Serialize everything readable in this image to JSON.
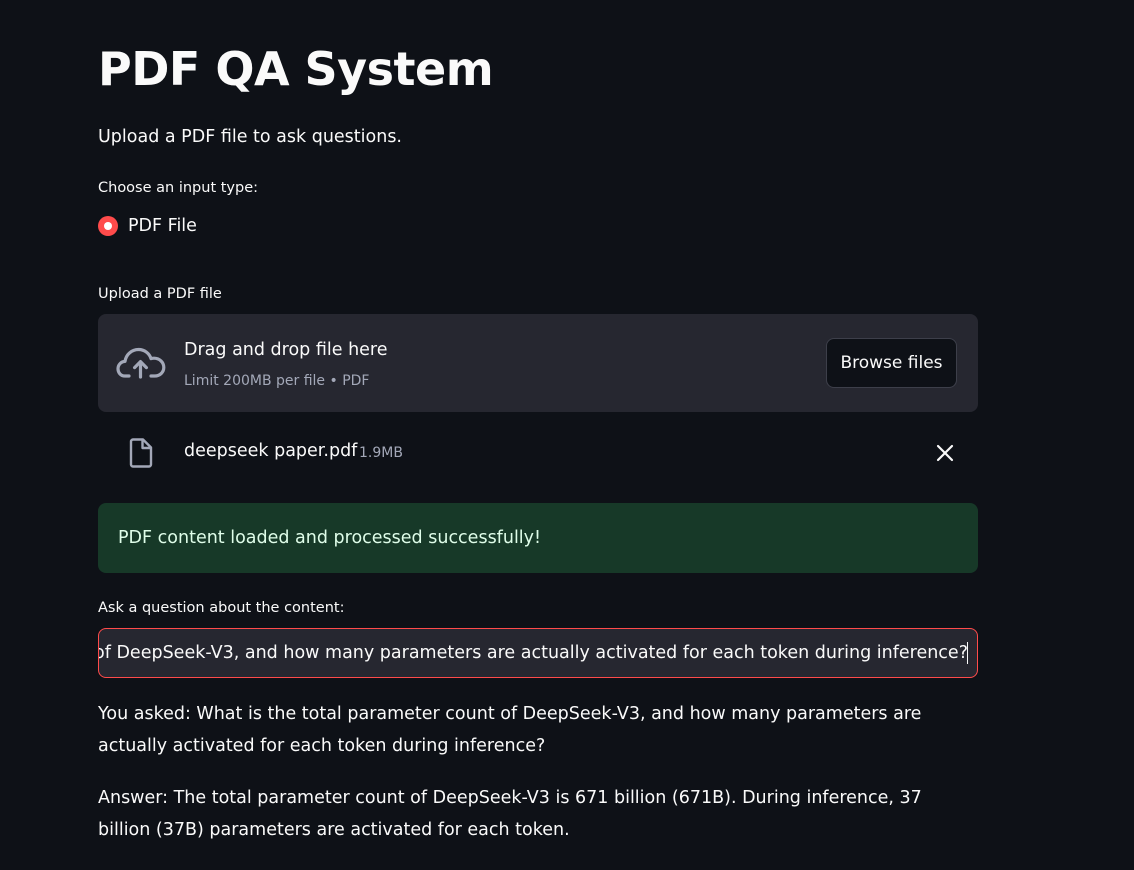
{
  "app": {
    "title": "PDF QA System",
    "subtitle": "Upload a PDF file to ask questions."
  },
  "input_type": {
    "label": "Choose an input type:",
    "options": [
      "PDF File"
    ],
    "selected": "PDF File"
  },
  "uploader": {
    "label": "Upload a PDF file",
    "drop_title": "Drag and drop file here",
    "drop_limit": "Limit 200MB per file • PDF",
    "browse_label": "Browse files",
    "file_name": "deepseek paper.pdf",
    "file_size": "1.9MB"
  },
  "status": {
    "success_message": "PDF content loaded and processed successfully!"
  },
  "question": {
    "label": "Ask a question about the content:",
    "value": "What is the total parameter count of DeepSeek-V3, and how many parameters are actually activated for each token during inference?"
  },
  "results": {
    "asked": "You asked: What is the total parameter count of DeepSeek-V3, and how many parameters are actually activated for each token during inference?",
    "answer": "Answer: The total parameter count of DeepSeek-V3 is 671 billion (671B). During inference, 37 billion (37B) parameters are activated for each token."
  },
  "colors": {
    "background": "#0e1117",
    "accent": "#ff4b4b",
    "panel": "#262730",
    "success_bg": "#173928",
    "success_text": "#dffde9",
    "muted_text": "#a3a8b8"
  },
  "icons": {
    "upload": "cloud-upload-icon",
    "file": "file-icon",
    "remove": "close-icon"
  }
}
